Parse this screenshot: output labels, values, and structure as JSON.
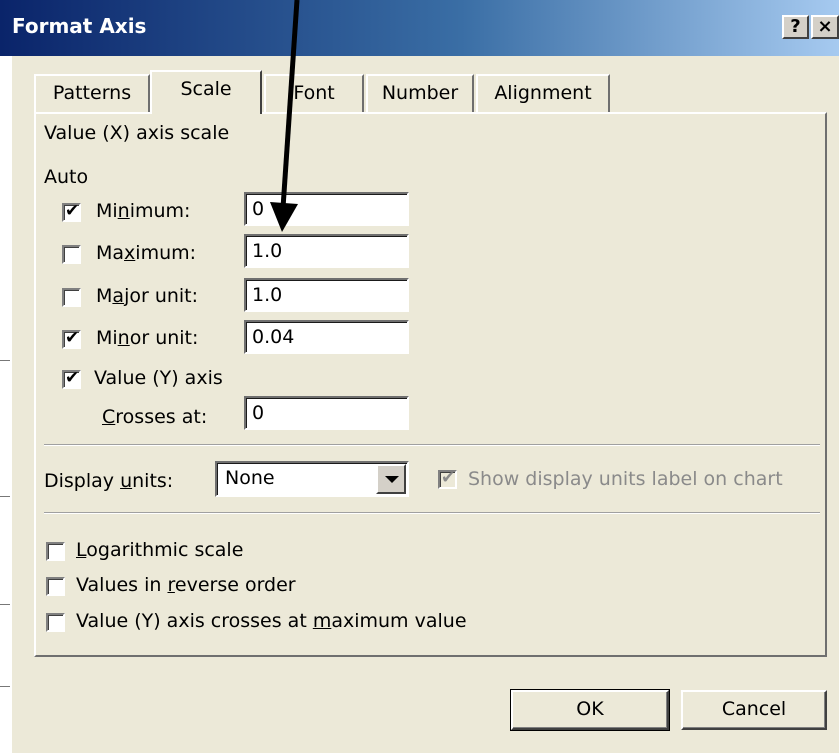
{
  "dialog": {
    "title": "Format Axis",
    "help_glyph": "?",
    "close_glyph": "×"
  },
  "tabs": [
    {
      "label": "Patterns",
      "active": false
    },
    {
      "label": "Scale",
      "active": true
    },
    {
      "label": "Font",
      "active": false
    },
    {
      "label": "Number",
      "active": false
    },
    {
      "label": "Alignment",
      "active": false
    }
  ],
  "scale": {
    "section_title": "Value (X) axis scale",
    "auto_label": "Auto",
    "minimum": {
      "label_pre": "Mi",
      "label_u": "n",
      "label_post": "imum:",
      "checked": true,
      "value": "0"
    },
    "maximum": {
      "label_pre": "Ma",
      "label_u": "x",
      "label_post": "imum:",
      "checked": false,
      "value": "1.0"
    },
    "major": {
      "label_pre": "M",
      "label_u": "a",
      "label_post": "jor unit:",
      "checked": false,
      "value": "1.0"
    },
    "minor": {
      "label_pre": "Mi",
      "label_u": "n",
      "label_post": "or unit:",
      "checked": true,
      "value": "0.04"
    },
    "crosses_auto": {
      "label": "Value (Y) axis",
      "checked": true
    },
    "crosses_at": {
      "label_u": "C",
      "label_post": "rosses at:",
      "value": "0"
    },
    "display_units": {
      "label_pre": "Display ",
      "label_u": "u",
      "label_post": "nits:",
      "selected": "None"
    },
    "show_units_label": {
      "label": "Show display units label on chart",
      "checked": true,
      "disabled": true
    },
    "logarithmic": {
      "label_u": "L",
      "label_post": "ogarithmic scale",
      "checked": false
    },
    "reverse": {
      "label_pre": "Values in ",
      "label_u": "r",
      "label_post": "everse order",
      "checked": false
    },
    "crosses_max": {
      "label_pre": "Value (Y) axis crosses at ",
      "label_u": "m",
      "label_post": "aximum value",
      "checked": false
    }
  },
  "buttons": {
    "ok": "OK",
    "cancel": "Cancel"
  },
  "colors": {
    "titlebar_start": "#0a246a",
    "dialog_face": "#ece9d8"
  }
}
